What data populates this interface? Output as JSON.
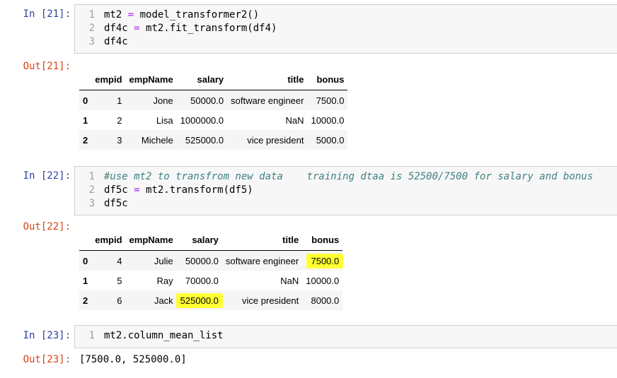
{
  "cells": [
    {
      "in_prompt": "In [21]:",
      "code": [
        {
          "num": "1",
          "parts": [
            {
              "t": "mt2 ",
              "k": "tx"
            },
            {
              "t": "=",
              "k": "op"
            },
            {
              "t": " model_transformer2()",
              "k": "tx"
            }
          ]
        },
        {
          "num": "2",
          "parts": [
            {
              "t": "df4c ",
              "k": "tx"
            },
            {
              "t": "=",
              "k": "op"
            },
            {
              "t": " mt2.fit_transform(df4)",
              "k": "tx"
            }
          ]
        },
        {
          "num": "3",
          "parts": [
            {
              "t": "df4c",
              "k": "tx"
            }
          ]
        }
      ],
      "out_prompt": "Out[21]:",
      "table": {
        "columns": [
          "",
          "empid",
          "empName",
          "salary",
          "title",
          "bonus"
        ],
        "rows": [
          [
            "0",
            "1",
            "Jone",
            "50000.0",
            "software engineer",
            "7500.0"
          ],
          [
            "1",
            "2",
            "Lisa",
            "1000000.0",
            "NaN",
            "10000.0"
          ],
          [
            "2",
            "3",
            "Michele",
            "525000.0",
            "vice president",
            "5000.0"
          ]
        ]
      }
    },
    {
      "in_prompt": "In [22]:",
      "code": [
        {
          "num": "1",
          "parts": [
            {
              "t": "#use mt2 to transfrom new data    training dtaa is 52500/7500 for salary and bonus",
              "k": "cm"
            }
          ]
        },
        {
          "num": "2",
          "parts": [
            {
              "t": "df5c ",
              "k": "tx"
            },
            {
              "t": "=",
              "k": "op"
            },
            {
              "t": " mt2.transform(df5)",
              "k": "tx"
            }
          ]
        },
        {
          "num": "3",
          "parts": [
            {
              "t": "df5c",
              "k": "tx"
            }
          ]
        }
      ],
      "out_prompt": "Out[22]:",
      "table": {
        "columns": [
          "",
          "empid",
          "empName",
          "salary",
          "title",
          "bonus"
        ],
        "rows": [
          [
            "0",
            "4",
            "Julie",
            "50000.0",
            "software engineer",
            "7500.0"
          ],
          [
            "1",
            "5",
            "Ray",
            "70000.0",
            "NaN",
            "10000.0"
          ],
          [
            "2",
            "6",
            "Jack",
            "525000.0",
            "vice president",
            "8000.0"
          ]
        ]
      }
    },
    {
      "in_prompt": "In [23]:",
      "code": [
        {
          "num": "1",
          "parts": [
            {
              "t": "mt2.column_mean_list",
              "k": "tx"
            }
          ]
        }
      ],
      "out_prompt": "Out[23]:",
      "output_text": "[7500.0, 525000.0]"
    }
  ],
  "highlight_color": "#ffff33"
}
